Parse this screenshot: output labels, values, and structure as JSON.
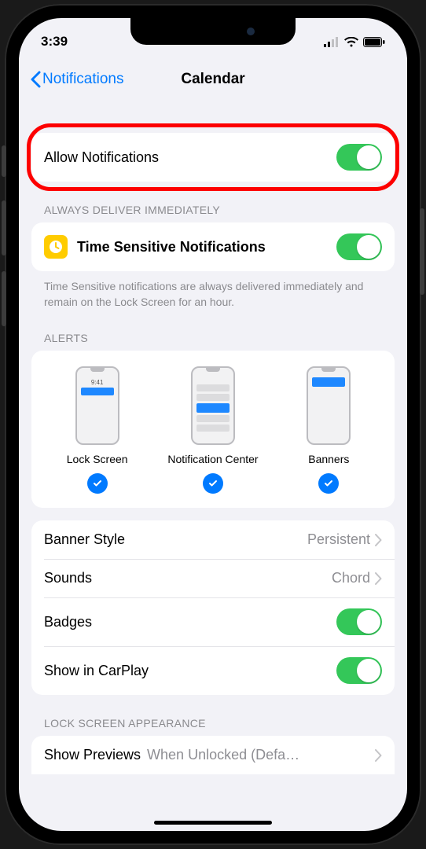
{
  "status": {
    "time": "3:39"
  },
  "nav": {
    "back": "Notifications",
    "title": "Calendar"
  },
  "allow": {
    "label": "Allow Notifications",
    "on": true
  },
  "deliverHeader": "ALWAYS DELIVER IMMEDIATELY",
  "timeSensitive": {
    "label": "Time Sensitive Notifications",
    "on": true
  },
  "timeSensitiveFooter": "Time Sensitive notifications are always delivered immediately and remain on the Lock Screen for an hour.",
  "alertsHeader": "ALERTS",
  "alerts": {
    "lock": {
      "label": "Lock Screen",
      "checked": true,
      "mockTime": "9:41"
    },
    "center": {
      "label": "Notification Center",
      "checked": true
    },
    "banners": {
      "label": "Banners",
      "checked": true
    }
  },
  "bannerStyle": {
    "label": "Banner Style",
    "value": "Persistent"
  },
  "sounds": {
    "label": "Sounds",
    "value": "Chord"
  },
  "badges": {
    "label": "Badges",
    "on": true
  },
  "carplay": {
    "label": "Show in CarPlay",
    "on": true
  },
  "lockHeader": "LOCK SCREEN APPEARANCE",
  "previews": {
    "label": "Show Previews",
    "value": "When Unlocked (Defa…"
  }
}
